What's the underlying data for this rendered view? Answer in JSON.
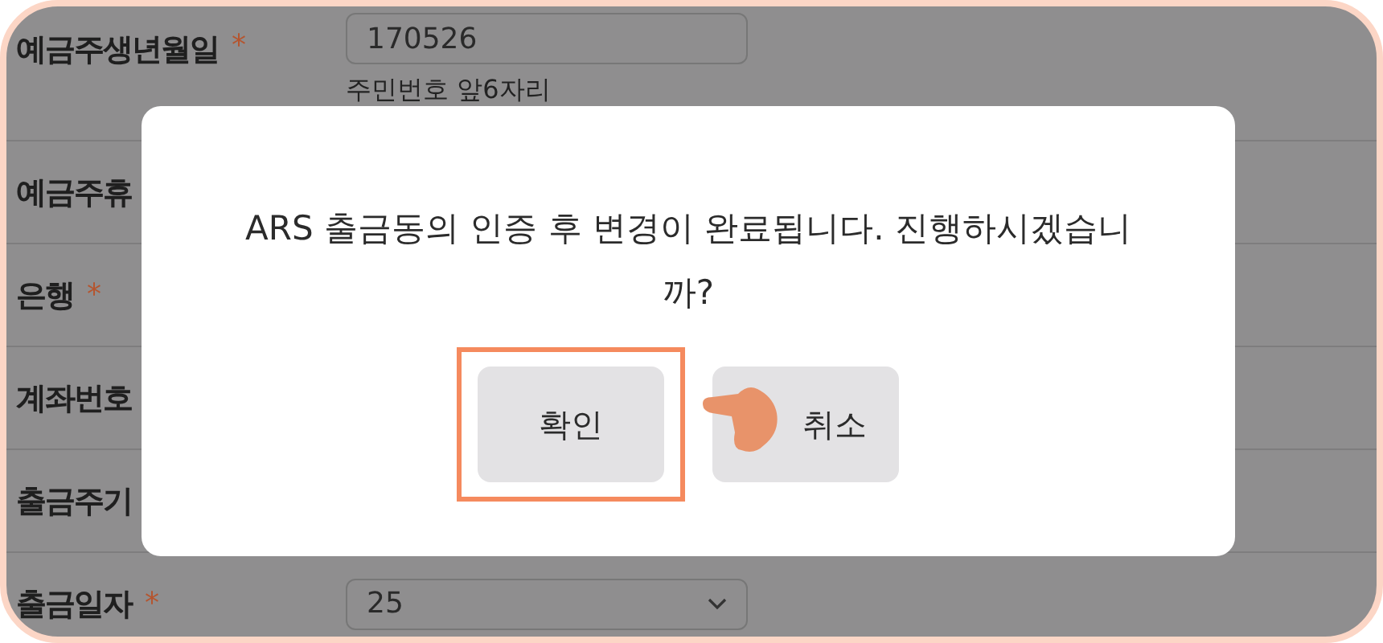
{
  "form": {
    "rows": [
      {
        "label": "예금주생년월일",
        "mark": "*",
        "kind": "text",
        "value": "170526",
        "hint": "주민번호 앞6자리"
      },
      {
        "label": "예금주휴"
      },
      {
        "label": "은행",
        "mark": "*"
      },
      {
        "label": "계좌번호"
      },
      {
        "label": "출금주기"
      },
      {
        "label": "출금일자",
        "mark": "*",
        "kind": "select",
        "value": "25"
      }
    ]
  },
  "dialog": {
    "message": "ARS 출금동의 인증 후 변경이 완료됩니다. 진행하시겠습니까?",
    "buttons": [
      {
        "label": "확인",
        "highlighted": true
      },
      {
        "label": "취소",
        "highlighted": false,
        "pointer": true
      }
    ]
  }
}
